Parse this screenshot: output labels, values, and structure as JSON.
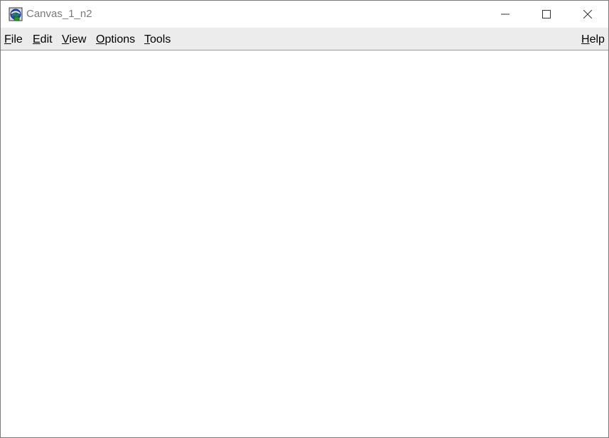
{
  "window": {
    "title": "Canvas_1_n2",
    "app_icon": "canvas-app-icon",
    "controls": {
      "minimize_icon": "minimize-icon",
      "maximize_icon": "maximize-icon",
      "close_icon": "close-icon"
    }
  },
  "menubar": {
    "file": {
      "first": "F",
      "rest": "ile"
    },
    "edit": {
      "first": "E",
      "rest": "dit"
    },
    "view": {
      "first": "V",
      "rest": "iew"
    },
    "options": {
      "first": "O",
      "rest": "ptions"
    },
    "tools": {
      "first": "T",
      "rest": "ools"
    },
    "help": {
      "first": "H",
      "rest": "elp"
    }
  },
  "colors": {
    "menubar_bg": "#ececec",
    "title_text": "#7a7a7a",
    "canvas_bg": "#ffffff"
  }
}
